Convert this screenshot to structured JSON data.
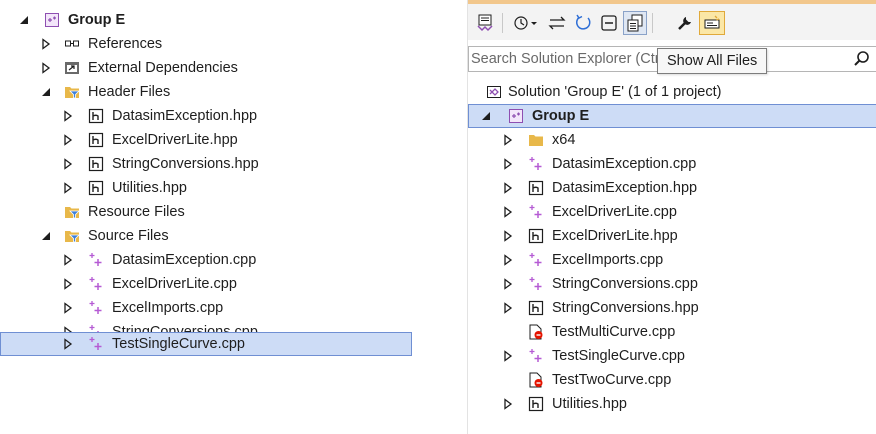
{
  "colors": {
    "selection": "#cddcf6",
    "selection_border": "#6f8fd3",
    "header_strip": "#f2c78c",
    "cpp_icon": "#b55bd4",
    "folder_icon": "#e8b84a"
  },
  "left_tree": {
    "project": "Group E",
    "references": "References",
    "external_dependencies": "External Dependencies",
    "header_files": "Header Files",
    "headers": [
      "DatasimException.hpp",
      "ExcelDriverLite.hpp",
      "StringConversions.hpp",
      "Utilities.hpp"
    ],
    "resource_files": "Resource Files",
    "source_files": "Source Files",
    "sources": [
      "DatasimException.cpp",
      "ExcelDriverLite.cpp",
      "ExcelImports.cpp",
      "StringConversions.cpp",
      "TestSingleCurve.cpp"
    ]
  },
  "right_panel": {
    "search_placeholder": "Search Solution Explorer (Ctrl+;)",
    "tooltip": "Show All Files",
    "solution": "Solution 'Group E' (1 of 1 project)",
    "project": "Group E",
    "items": [
      "x64",
      "DatasimException.cpp",
      "DatasimException.hpp",
      "ExcelDriverLite.cpp",
      "ExcelDriverLite.hpp",
      "ExcelImports.cpp",
      "StringConversions.cpp",
      "StringConversions.hpp",
      "TestMultiCurve.cpp",
      "TestSingleCurve.cpp",
      "TestTwoCurve.cpp",
      "Utilities.hpp"
    ]
  },
  "icons": [
    "expanded-arrow-icon",
    "collapsed-arrow-icon",
    "project-icon",
    "references-icon",
    "external-deps-icon",
    "filter-folder-icon",
    "header-file-icon",
    "cpp-file-icon",
    "excluded-file-icon",
    "folder-icon",
    "solution-icon",
    "sync-icon",
    "history-icon",
    "back-forward-icon",
    "refresh-icon",
    "collapse-all-icon",
    "show-all-files-icon",
    "properties-wrench-icon",
    "preview-icon",
    "search-icon"
  ]
}
